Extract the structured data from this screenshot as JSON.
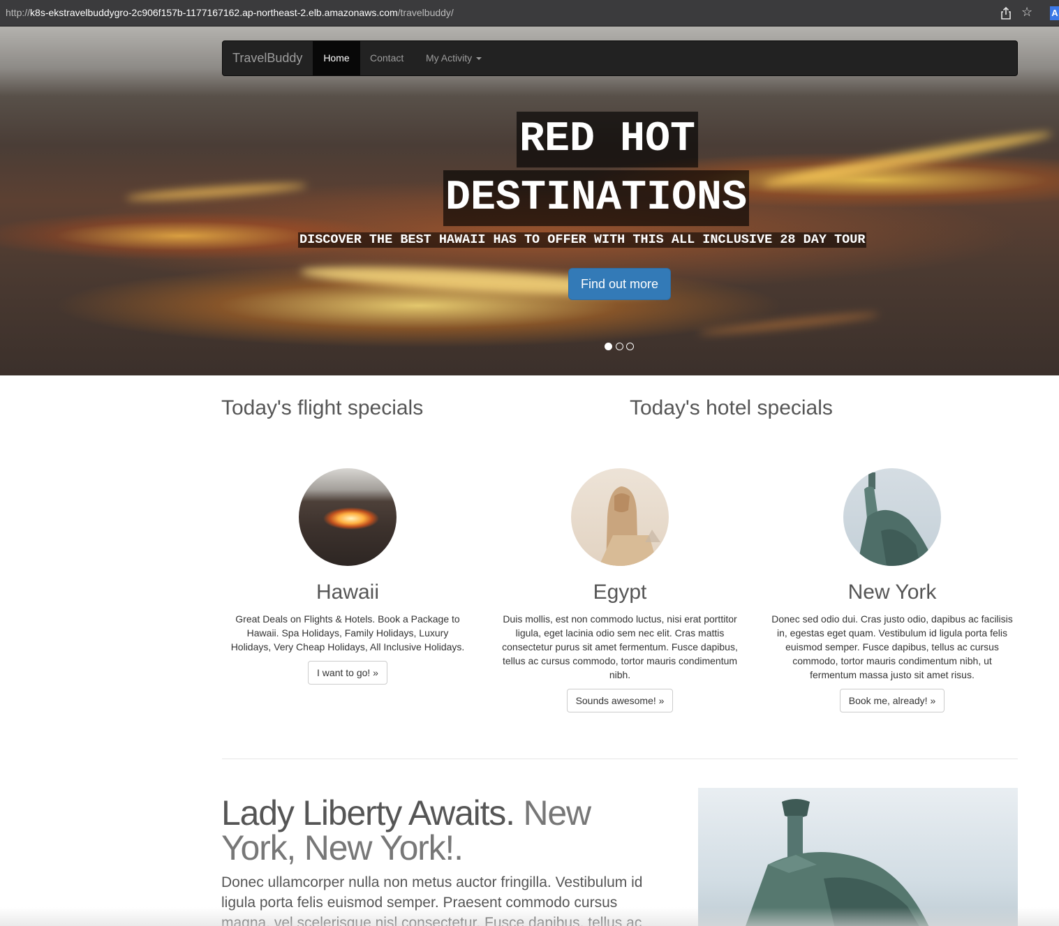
{
  "browser": {
    "url_prefix": "http://",
    "url_host": "k8s-ekstravelbuddygro-2c906f157b-1177167162.ap-northeast-2.elb.amazonaws.com",
    "url_path": "/travelbuddy/",
    "share_icon": "share-icon",
    "bookmark_icon": "star-icon",
    "extension_label": "A"
  },
  "nav": {
    "brand": "TravelBuddy",
    "items": [
      {
        "label": "Home",
        "active": true
      },
      {
        "label": "Contact",
        "active": false
      },
      {
        "label": "My Activity",
        "dropdown": true
      }
    ]
  },
  "hero": {
    "headline_line1": "RED HOT",
    "headline_line2": "DESTINATIONS",
    "subheadline": "DISCOVER THE BEST HAWAII HAS TO OFFER WITH THIS ALL INCLUSIVE 28 DAY TOUR",
    "cta": "Find out more",
    "carousel_slides": 3,
    "active_slide": 1
  },
  "specials": {
    "flight_title": "Today's flight specials",
    "hotel_title": "Today's hotel specials"
  },
  "destinations": [
    {
      "name": "Hawaii",
      "text": "Great Deals on Flights & Hotels. Book a Package to Hawaii. Spa Holidays, Family Holidays, Luxury Holidays, Very Cheap Holidays, All Inclusive Holidays.",
      "button": "I want to go! »"
    },
    {
      "name": "Egypt",
      "text": "Duis mollis, est non commodo luctus, nisi erat porttitor ligula, eget lacinia odio sem nec elit. Cras mattis consectetur purus sit amet fermentum. Fusce dapibus, tellus ac cursus commodo, tortor mauris condimentum nibh.",
      "button": "Sounds awesome! »"
    },
    {
      "name": "New York",
      "text": "Donec sed odio dui. Cras justo odio, dapibus ac facilisis in, egestas eget quam. Vestibulum id ligula porta felis euismod semper. Fusce dapibus, tellus ac cursus commodo, tortor mauris condimentum nibh, ut fermentum massa justo sit amet risus.",
      "button": "Book me, already! »"
    }
  ],
  "featurette": {
    "heading": "Lady Liberty Awaits.",
    "heading_muted": "New York, New York!.",
    "text": "Donec ullamcorper nulla non metus auctor fringilla. Vestibulum id ligula porta felis euismod semper. Praesent commodo cursus magna, vel scelerisque nisl consectetur. Fusce dapibus, tellus ac cursus commodo,"
  }
}
